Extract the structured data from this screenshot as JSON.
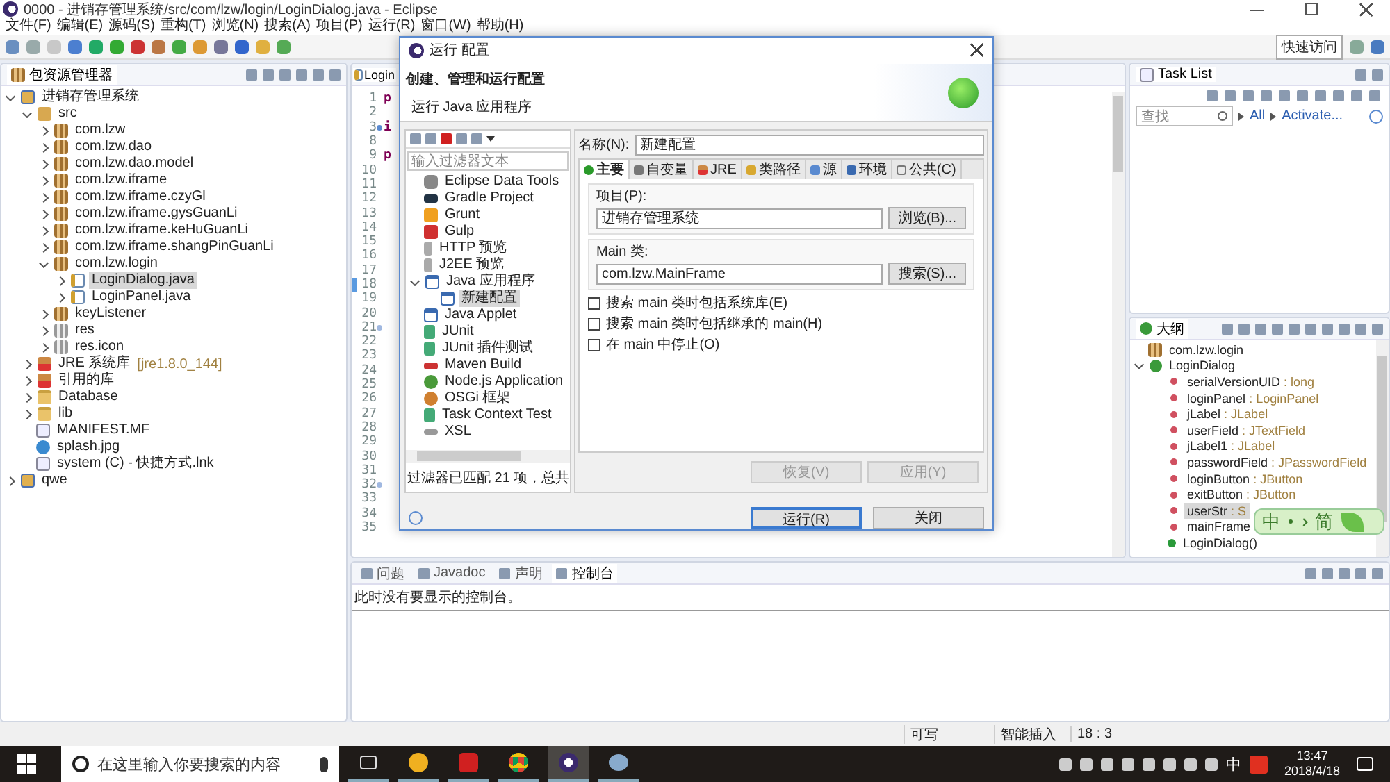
{
  "window": {
    "title": "0000 - 进销存管理系统/src/com/lzw/login/LoginDialog.java - Eclipse"
  },
  "menu": [
    "文件(F)",
    "编辑(E)",
    "源码(S)",
    "重构(T)",
    "浏览(N)",
    "搜索(A)",
    "项目(P)",
    "运行(R)",
    "窗口(W)",
    "帮助(H)"
  ],
  "quick_access": "快速访问",
  "package_explorer": {
    "title": "包资源管理器",
    "tree": [
      {
        "label": "进销存管理系统",
        "kind": "project",
        "expanded": true,
        "selected": false,
        "children": [
          {
            "label": "src",
            "kind": "srcfolder",
            "expanded": true,
            "selected": false,
            "children": [
              {
                "label": "com.lzw",
                "kind": "package",
                "expanded": false,
                "selected": false
              },
              {
                "label": "com.lzw.dao",
                "kind": "package",
                "expanded": false,
                "selected": false
              },
              {
                "label": "com.lzw.dao.model",
                "kind": "package",
                "expanded": false,
                "selected": false
              },
              {
                "label": "com.lzw.iframe",
                "kind": "package",
                "expanded": false,
                "selected": false
              },
              {
                "label": "com.lzw.iframe.czyGl",
                "kind": "package",
                "expanded": false,
                "selected": false
              },
              {
                "label": "com.lzw.iframe.gysGuanLi",
                "kind": "package",
                "expanded": false,
                "selected": false
              },
              {
                "label": "com.lzw.iframe.keHuGuanLi",
                "kind": "package",
                "expanded": false,
                "selected": false
              },
              {
                "label": "com.lzw.iframe.shangPinGuanLi",
                "kind": "package",
                "expanded": false,
                "selected": false
              },
              {
                "label": "com.lzw.login",
                "kind": "package",
                "expanded": true,
                "selected": false,
                "children": [
                  {
                    "label": "LoginDialog.java",
                    "kind": "java",
                    "expanded": false,
                    "selected": true
                  },
                  {
                    "label": "LoginPanel.java",
                    "kind": "java",
                    "expanded": false,
                    "selected": false
                  }
                ]
              },
              {
                "label": "keyListener",
                "kind": "package",
                "expanded": false,
                "selected": false
              },
              {
                "label": "res",
                "kind": "respackage",
                "expanded": false,
                "selected": false
              },
              {
                "label": "res.icon",
                "kind": "respackage",
                "expanded": false,
                "selected": false
              }
            ]
          },
          {
            "label": "JRE 系统库",
            "decoration": "[jre1.8.0_144]",
            "kind": "library",
            "expanded": false,
            "selected": false
          },
          {
            "label": "引用的库",
            "kind": "library",
            "expanded": false,
            "selected": false
          },
          {
            "label": "Database",
            "kind": "folder",
            "expanded": false,
            "selected": false
          },
          {
            "label": "lib",
            "kind": "folder",
            "expanded": false,
            "selected": false
          },
          {
            "label": "MANIFEST.MF",
            "kind": "file",
            "selected": false
          },
          {
            "label": "splash.jpg",
            "kind": "image",
            "selected": false
          },
          {
            "label": "system (C) - 快捷方式.lnk",
            "kind": "file",
            "selected": false
          }
        ]
      },
      {
        "label": "qwe",
        "kind": "project",
        "expanded": false,
        "selected": false
      }
    ]
  },
  "editor": {
    "tab": "Login",
    "lines": [
      {
        "number": "1",
        "code": "p"
      },
      {
        "number": "2"
      },
      {
        "number": "3",
        "code": "i",
        "folded": true
      },
      {
        "number": "8"
      },
      {
        "number": "9",
        "code": "p"
      },
      {
        "number": "10"
      },
      {
        "number": "11"
      },
      {
        "number": "12"
      },
      {
        "number": "13"
      },
      {
        "number": "14"
      },
      {
        "number": "15"
      },
      {
        "number": "16"
      },
      {
        "number": "17"
      },
      {
        "number": "18",
        "current": true
      },
      {
        "number": "19"
      },
      {
        "number": "20"
      },
      {
        "number": "21",
        "folded": false
      },
      {
        "number": "22"
      },
      {
        "number": "23"
      },
      {
        "number": "24"
      },
      {
        "number": "25"
      },
      {
        "number": "26"
      },
      {
        "number": "27"
      },
      {
        "number": "28"
      },
      {
        "number": "29"
      },
      {
        "number": "30"
      },
      {
        "number": "31"
      },
      {
        "number": "32",
        "folded": false
      },
      {
        "number": "33"
      },
      {
        "number": "34"
      },
      {
        "number": "35"
      }
    ]
  },
  "task_list": {
    "title": "Task List",
    "search": {
      "placeholder": "查找"
    },
    "links": [
      "All",
      "Activate..."
    ]
  },
  "outline": {
    "title": "大纲",
    "items": [
      {
        "name": "com.lzw.login",
        "kind": "package",
        "selected": false
      },
      {
        "name": "LoginDialog",
        "kind": "class",
        "expanded": true,
        "selected": false,
        "children": [
          {
            "name": "serialVersionUID",
            "detail": ": long",
            "kind": "constant",
            "selected": false
          },
          {
            "name": "loginPanel",
            "detail": ": LoginPanel",
            "kind": "field",
            "selected": false
          },
          {
            "name": "jLabel",
            "detail": ": JLabel",
            "kind": "field",
            "selected": false
          },
          {
            "name": "userField",
            "detail": ": JTextField",
            "kind": "field",
            "selected": false
          },
          {
            "name": "jLabel1",
            "detail": ": JLabel",
            "kind": "field",
            "selected": false
          },
          {
            "name": "passwordField",
            "detail": ": JPasswordField",
            "kind": "field",
            "selected": false
          },
          {
            "name": "loginButton",
            "detail": ": JButton",
            "kind": "field",
            "selected": false
          },
          {
            "name": "exitButton",
            "detail": ": JButton",
            "kind": "field",
            "selected": false
          },
          {
            "name": "userStr",
            "detail": ": S",
            "kind": "static_field",
            "selected": true
          },
          {
            "name": "mainFrame",
            "kind": "field",
            "selected": false
          },
          {
            "name": "LoginDialog()",
            "kind": "constructor",
            "selected": false
          }
        ]
      }
    ]
  },
  "console": {
    "tabs": [
      {
        "label": "问题",
        "selected": false
      },
      {
        "label": "Javadoc",
        "selected": false
      },
      {
        "label": "声明",
        "selected": false
      },
      {
        "label": "控制台",
        "selected": true
      }
    ],
    "message": "此时没有要显示的控制台。"
  },
  "status_bar": [
    "可写",
    "智能插入",
    "18 : 3"
  ],
  "dialog": {
    "title": "运行 配置",
    "heading": "创建、管理和运行配置",
    "subheading": "运行 Java 应用程序",
    "filter": {
      "placeholder": "输入过滤器文本"
    },
    "types": [
      {
        "label": "Eclipse Data Tools",
        "kind": "db",
        "selected": false
      },
      {
        "label": "Gradle Project",
        "kind": "gradle",
        "selected": false
      },
      {
        "label": "Grunt",
        "kind": "grunt",
        "selected": false
      },
      {
        "label": "Gulp",
        "kind": "gulp",
        "selected": false
      },
      {
        "label": "HTTP 预览",
        "kind": "doc",
        "selected": false
      },
      {
        "label": "J2EE 预览",
        "kind": "doc",
        "selected": false
      },
      {
        "label": "Java 应用程序",
        "kind": "app",
        "expanded": true,
        "selected": false,
        "children": [
          {
            "label": "新建配置",
            "kind": "app",
            "selected": true
          }
        ]
      },
      {
        "label": "Java Applet",
        "kind": "applet",
        "selected": false
      },
      {
        "label": "JUnit",
        "kind": "junit",
        "selected": false
      },
      {
        "label": "JUnit 插件测试",
        "kind": "junit",
        "selected": false
      },
      {
        "label": "Maven Build",
        "kind": "maven",
        "selected": false
      },
      {
        "label": "Node.js Application",
        "kind": "node",
        "selected": false
      },
      {
        "label": "OSGi 框架",
        "kind": "osgi",
        "selected": false
      },
      {
        "label": "Task Context Test",
        "kind": "junit",
        "selected": false
      },
      {
        "label": "XSL",
        "kind": "xsl",
        "selected": false
      }
    ],
    "filter_status": "过滤器已匹配 21 项，总共",
    "name_label": "名称(N):",
    "name_value": "新建配置",
    "tabs": [
      {
        "label": "主要",
        "selected": true
      },
      {
        "label": "自变量",
        "selected": false
      },
      {
        "label": "JRE",
        "selected": false
      },
      {
        "label": "类路径",
        "selected": false
      },
      {
        "label": "源",
        "selected": false
      },
      {
        "label": "环境",
        "selected": false
      },
      {
        "label": "公共(C)",
        "selected": false
      }
    ],
    "project": {
      "label": "项目(P):",
      "value": "进销存管理系统",
      "button": "浏览(B)..."
    },
    "main_class": {
      "label": "Main 类:",
      "value": "com.lzw.MainFrame",
      "button": "搜索(S)..."
    },
    "options": [
      {
        "label": "搜索 main 类时包括系统库(E)",
        "checked": false
      },
      {
        "label": "搜索 main 类时包括继承的 main(H)",
        "checked": false
      },
      {
        "label": "在 main 中停止(O)",
        "checked": false
      }
    ],
    "apply_buttons": [
      {
        "label": "恢复(V)",
        "disabled": true
      },
      {
        "label": "应用(Y)",
        "disabled": true
      }
    ],
    "buttons": [
      {
        "label": "运行(R)",
        "default": true
      },
      {
        "label": "关闭",
        "default": false
      }
    ]
  },
  "ime_bar": [
    "中",
    "简"
  ],
  "taskbar": {
    "search": {
      "placeholder": "在这里输入你要搜索的内容"
    },
    "apps": [
      {
        "kind": "taskview",
        "active": false
      },
      {
        "kind": "browser",
        "active": false
      },
      {
        "kind": "music",
        "active": false
      },
      {
        "kind": "chrome",
        "active": false
      },
      {
        "kind": "eclipse",
        "active": true
      },
      {
        "kind": "paint",
        "active": false
      }
    ],
    "ime": "中",
    "time": "13:47",
    "date": "2018/4/18"
  }
}
